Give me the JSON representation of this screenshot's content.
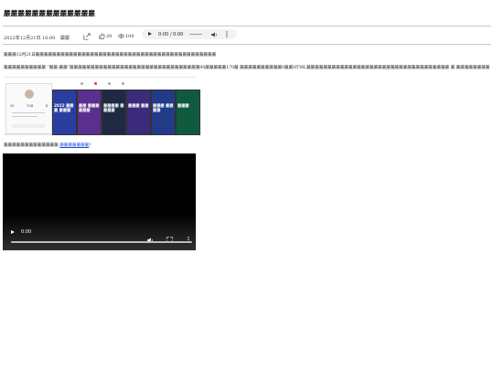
{
  "article": {
    "title": "嚴嚴嚴嚴嚴嚴嚴嚴嚴嚴嚴嚴嚴",
    "date": "2022年12月21日 16:00",
    "author": "嚴嚴",
    "likes": "20",
    "views": "100"
  },
  "audio": {
    "time": "0:00 / 0:00"
  },
  "paragraphs": {
    "p1": "嚴嚴嚴12月21日嚴嚴嚴嚴嚴嚴嚴嚴嚴嚴嚴嚴嚴嚴嚴嚴嚴嚴嚴嚴嚴嚴嚴嚴嚴嚴嚴嚴嚴嚴嚴嚴嚴嚴嚴嚴嚴嚴嚴嚴嚴嚴嚴",
    "p2": "嚴嚴嚴嚴嚴嚴嚴嚴嚴嚴 “嚴嚴-嚴嚴”嚴嚴嚴嚴嚴嚴嚴嚴嚴嚴嚴嚴嚴嚴嚴嚴嚴嚴嚴嚴嚴嚴嚴嚴嚴嚴嚴嚴嚴嚴嚴90嚴嚴嚴嚴嚴170嚴 嚴嚴嚴嚴嚴嚴嚴嚴嚴嚴0嚴嚴HTML嚴嚴嚴嚴嚴嚴嚴嚴嚴嚴嚴嚴嚴嚴嚴嚴嚴嚴嚴嚴嚴嚴嚴嚴嚴嚴嚴嚴嚴嚴嚴嚴嚴嚴 嚴 嚴嚴嚴嚴嚴嚴嚴嚴",
    "p3_text": "嚴嚴嚴嚴嚴嚴嚴嚴嚴嚴嚴嚴嚴 ",
    "p3_link": "嚴嚴嚴嚴嚴嚴嚴",
    "p3_end": "！"
  },
  "screenshots": {
    "stats": [
      "10",
      "134",
      "4"
    ],
    "tiles": [
      {
        "caption": "2022 嚴嚴嚴 嚴嚴嚴",
        "color": "#2a3ea0"
      },
      {
        "caption": "嚴嚴 嚴嚴嚴 嚴嚴嚴",
        "color": "#5a2f8f"
      },
      {
        "caption": "嚴嚴嚴嚴 嚴嚴嚴嚴",
        "color": "#1e2a44"
      },
      {
        "caption": "嚴嚴嚴 嚴嚴",
        "color": "#3b2b7a"
      },
      {
        "caption": "嚴嚴嚴 嚴嚴嚴嚴",
        "color": "#213b86"
      },
      {
        "caption": "嚴嚴嚴",
        "color": "#0f5a3f"
      }
    ]
  },
  "video": {
    "time": "0:00"
  },
  "icons": {
    "share": "share-icon",
    "like": "thumbs-up-icon",
    "view": "eye-icon",
    "audio_play": "play-icon",
    "audio_volume": "volume-icon",
    "audio_more": "more-vertical-icon",
    "video_play": "play-icon",
    "video_volume": "volume-icon",
    "video_fullscreen": "fullscreen-icon",
    "video_more": "more-vertical-icon"
  },
  "colors": {
    "link": "#1a4fd6",
    "video_bg": "#000000",
    "audio_bg": "#f1f3f4",
    "like_dot": "#e4394b"
  }
}
